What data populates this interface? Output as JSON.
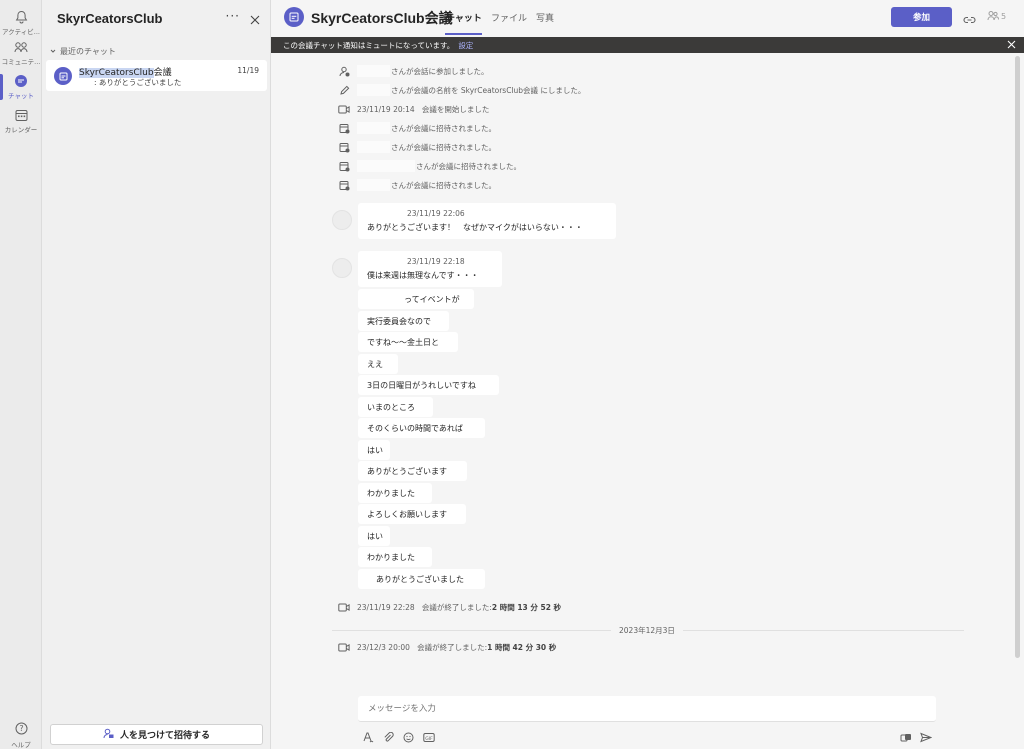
{
  "rail": {
    "activity": "アクティビ...",
    "community": "コミュニテ...",
    "chat": "チャット",
    "calendar": "カレンダー",
    "help": "ヘルプ"
  },
  "list": {
    "title": "SkyrCeatorsClub",
    "section": "最近のチャット",
    "chat_name_hl": "SkyrCeatorsClub",
    "chat_name_rest": "会議",
    "chat_preview": "ありがとうございました",
    "chat_date": "11/19",
    "invite": "人を見つけて招待する"
  },
  "header": {
    "title": "SkyrCeatorsClub会議",
    "tabs": [
      "チャット",
      "ファイル",
      "写真"
    ],
    "join": "参加",
    "participants": "5"
  },
  "banner": {
    "text": "この会議チャット通知はミュートになっています。",
    "link": "設定"
  },
  "events": [
    "さんが会話に参加しました。",
    "さんが会議の名前を SkyrCeatorsClub会議 にしました。",
    "会議を開始しました",
    "さんが会議に招待されました。",
    "さんが会議に招待されました。",
    "さんが会議に招待されました。",
    "さんが会議に招待されました。"
  ],
  "event_meeting_start_time": "23/11/19 20:14",
  "messages": {
    "first_time": "23/11/19 22:06",
    "first_text": "ありがとうございます！　なぜかマイクがはいらない・・・",
    "second_time": "23/11/19 22:18",
    "lines": [
      "僕は来週は無理なんです・・・",
      "ってイベントが",
      "実行委員会なので",
      "ですね〜〜金土日と",
      "ええ",
      "3日の日曜日がうれしいですね",
      "いまのところ",
      "そのくらいの時間であれば",
      "はい",
      "ありがとうございます",
      "わかりました",
      "よろしくお願いします",
      "はい",
      "わかりました",
      "ありがとうございました"
    ]
  },
  "end1": {
    "time": "23/11/19 22:28",
    "text": "会議が終了しました: ",
    "duration": "2 時間 13 分 52 秒"
  },
  "date_divider": "2023年12月3日",
  "end2": {
    "time": "23/12/3 20:00",
    "text": "会議が終了しました: ",
    "duration": "1 時間 42 分 30 秒"
  },
  "composer": {
    "placeholder": "メッセージを入力"
  },
  "colors": {
    "accent": "#5b5fc7",
    "banner": "#3b3a39"
  }
}
